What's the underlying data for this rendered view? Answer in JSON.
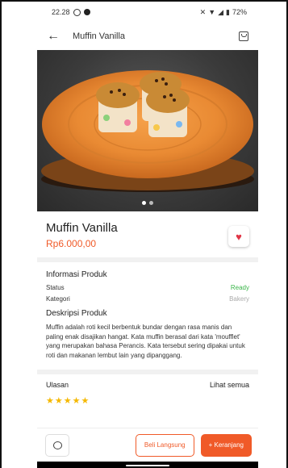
{
  "status_bar": {
    "time": "22.28",
    "battery": "72%"
  },
  "app_bar": {
    "title": "Muffin Vanilla"
  },
  "carousel": {
    "count": 2,
    "active_index": 0
  },
  "product": {
    "name": "Muffin Vanilla",
    "price": "Rp6.000,00"
  },
  "info": {
    "title": "Informasi Produk",
    "status_label": "Status",
    "status_value": "Ready",
    "category_label": "Kategori",
    "category_value": "Bakery"
  },
  "description": {
    "title": "Deskripsi Produk",
    "text": "Muffin adalah roti kecil berbentuk bundar dengan rasa manis dan paling enak disajikan hangat. Kata muffin berasal dari kata 'moufflet' yang merupakan bahasa Perancis. Kata tersebut sering dipakai untuk roti dan makanan lembut lain yang dipanggang."
  },
  "reviews": {
    "title": "Ulasan",
    "see_all": "Lihat semua",
    "stars": "★★★★★"
  },
  "bottom_bar": {
    "buy_now": "Beli Langsung",
    "add_cart": "+ Keranjang"
  },
  "colors": {
    "accent": "#f05a28",
    "ready": "#3bb54a",
    "heart": "#e03546"
  },
  "icons": {
    "back": "arrow-left-icon",
    "bag": "shopping-bag-icon",
    "favorite": "heart-icon",
    "chat": "chat-bubble-icon"
  }
}
